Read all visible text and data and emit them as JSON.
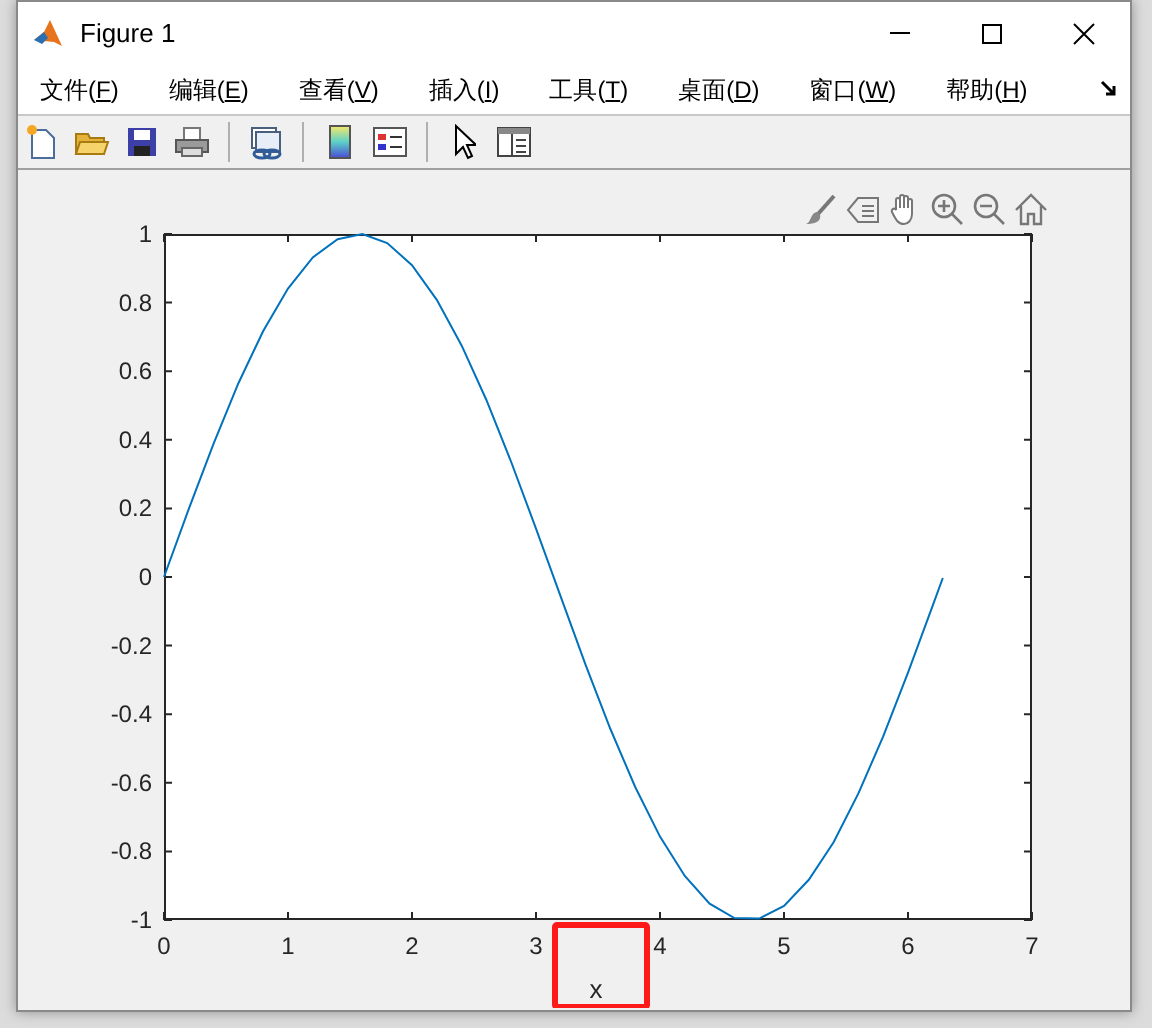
{
  "window": {
    "title": "Figure 1"
  },
  "menu": [
    {
      "text": "文件(",
      "key": "F",
      "tail": ")"
    },
    {
      "text": "编辑(",
      "key": "E",
      "tail": ")"
    },
    {
      "text": "查看(",
      "key": "V",
      "tail": ")"
    },
    {
      "text": "插入(",
      "key": "I",
      "tail": ")"
    },
    {
      "text": "工具(",
      "key": "T",
      "tail": ")"
    },
    {
      "text": "桌面(",
      "key": "D",
      "tail": ")"
    },
    {
      "text": "窗口(",
      "key": "W",
      "tail": ")"
    },
    {
      "text": "帮助(",
      "key": "H",
      "tail": ")"
    }
  ],
  "chart_data": {
    "type": "line",
    "xlabel": "x",
    "x": [
      0,
      0.2,
      0.4,
      0.6,
      0.8,
      1.0,
      1.2,
      1.4,
      1.6,
      1.8,
      2.0,
      2.2,
      2.4,
      2.6,
      2.8,
      3.0,
      3.2,
      3.4,
      3.6,
      3.8,
      4.0,
      4.2,
      4.4,
      4.6,
      4.8,
      5.0,
      5.2,
      5.4,
      5.6,
      5.8,
      6.0,
      6.2,
      6.28
    ],
    "series": [
      {
        "color": "#0072bd",
        "values": [
          0,
          0.199,
          0.389,
          0.565,
          0.717,
          0.841,
          0.932,
          0.985,
          1.0,
          0.974,
          0.909,
          0.808,
          0.675,
          0.516,
          0.335,
          0.141,
          -0.058,
          -0.256,
          -0.443,
          -0.612,
          -0.757,
          -0.872,
          -0.952,
          -0.994,
          -0.996,
          -0.959,
          -0.883,
          -0.773,
          -0.631,
          -0.465,
          -0.279,
          -0.083,
          -0.003
        ]
      }
    ],
    "xlim": [
      0,
      7
    ],
    "ylim": [
      -1,
      1
    ],
    "xticks": [
      0,
      1,
      2,
      3,
      4,
      5,
      6,
      7
    ],
    "yticks": [
      -1,
      -0.8,
      -0.6,
      -0.4,
      -0.2,
      0,
      0.2,
      0.4,
      0.6,
      0.8,
      1
    ]
  },
  "xlabel_highlighted": true
}
